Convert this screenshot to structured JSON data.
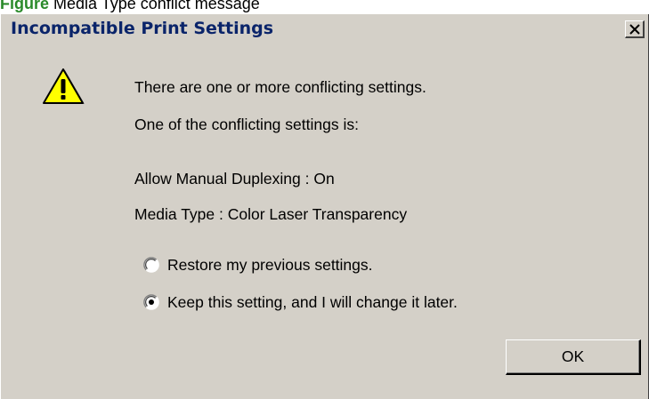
{
  "page_caption": {
    "lead": "Figure",
    "text": "Media Type conflict message"
  },
  "dialog": {
    "title": "Incompatible Print Settings",
    "close_icon": "close-icon",
    "warning_icon": "warning-icon",
    "message_line1": "There are one or more conflicting settings.",
    "message_line2": "One of the conflicting settings is:",
    "setting_line1": "Allow Manual Duplexing : On",
    "setting_line2": "Media Type : Color Laser Transparency",
    "options": [
      {
        "label": "Restore my previous settings.",
        "selected": false
      },
      {
        "label": "Keep this setting, and I will change it later.",
        "selected": true
      }
    ],
    "ok_label": "OK"
  }
}
